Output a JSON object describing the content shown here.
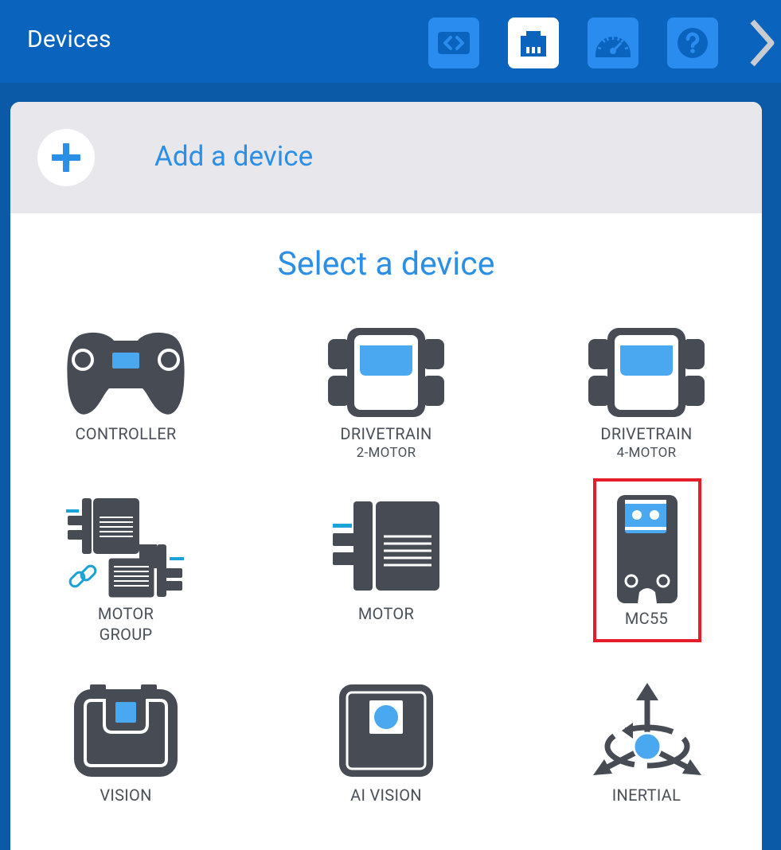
{
  "header": {
    "title": "Devices",
    "buttons": [
      {
        "name": "code-icon",
        "active": false
      },
      {
        "name": "port-icon",
        "active": true
      },
      {
        "name": "dashboard-icon",
        "active": false
      },
      {
        "name": "help-icon",
        "active": false
      }
    ]
  },
  "panel": {
    "add_label": "Add a device",
    "select_title": "Select a device",
    "devices": [
      {
        "label": "CONTROLLER",
        "sub": ""
      },
      {
        "label": "DRIVETRAIN",
        "sub": "2-MOTOR"
      },
      {
        "label": "DRIVETRAIN",
        "sub": "4-MOTOR"
      },
      {
        "label": "MOTOR",
        "label2": "GROUP",
        "sub": ""
      },
      {
        "label": "MOTOR",
        "sub": ""
      },
      {
        "label": "MC55",
        "sub": "",
        "highlighted": true
      },
      {
        "label": "VISION",
        "sub": ""
      },
      {
        "label": "AI VISION",
        "sub": ""
      },
      {
        "label": "INERTIAL",
        "sub": ""
      }
    ]
  },
  "colors": {
    "header_bg": "#0a63bd",
    "accent": "#2b8fe6",
    "icon_dark": "#474c54",
    "icon_blue": "#4aa8f0",
    "highlight": "#e81d2a"
  }
}
